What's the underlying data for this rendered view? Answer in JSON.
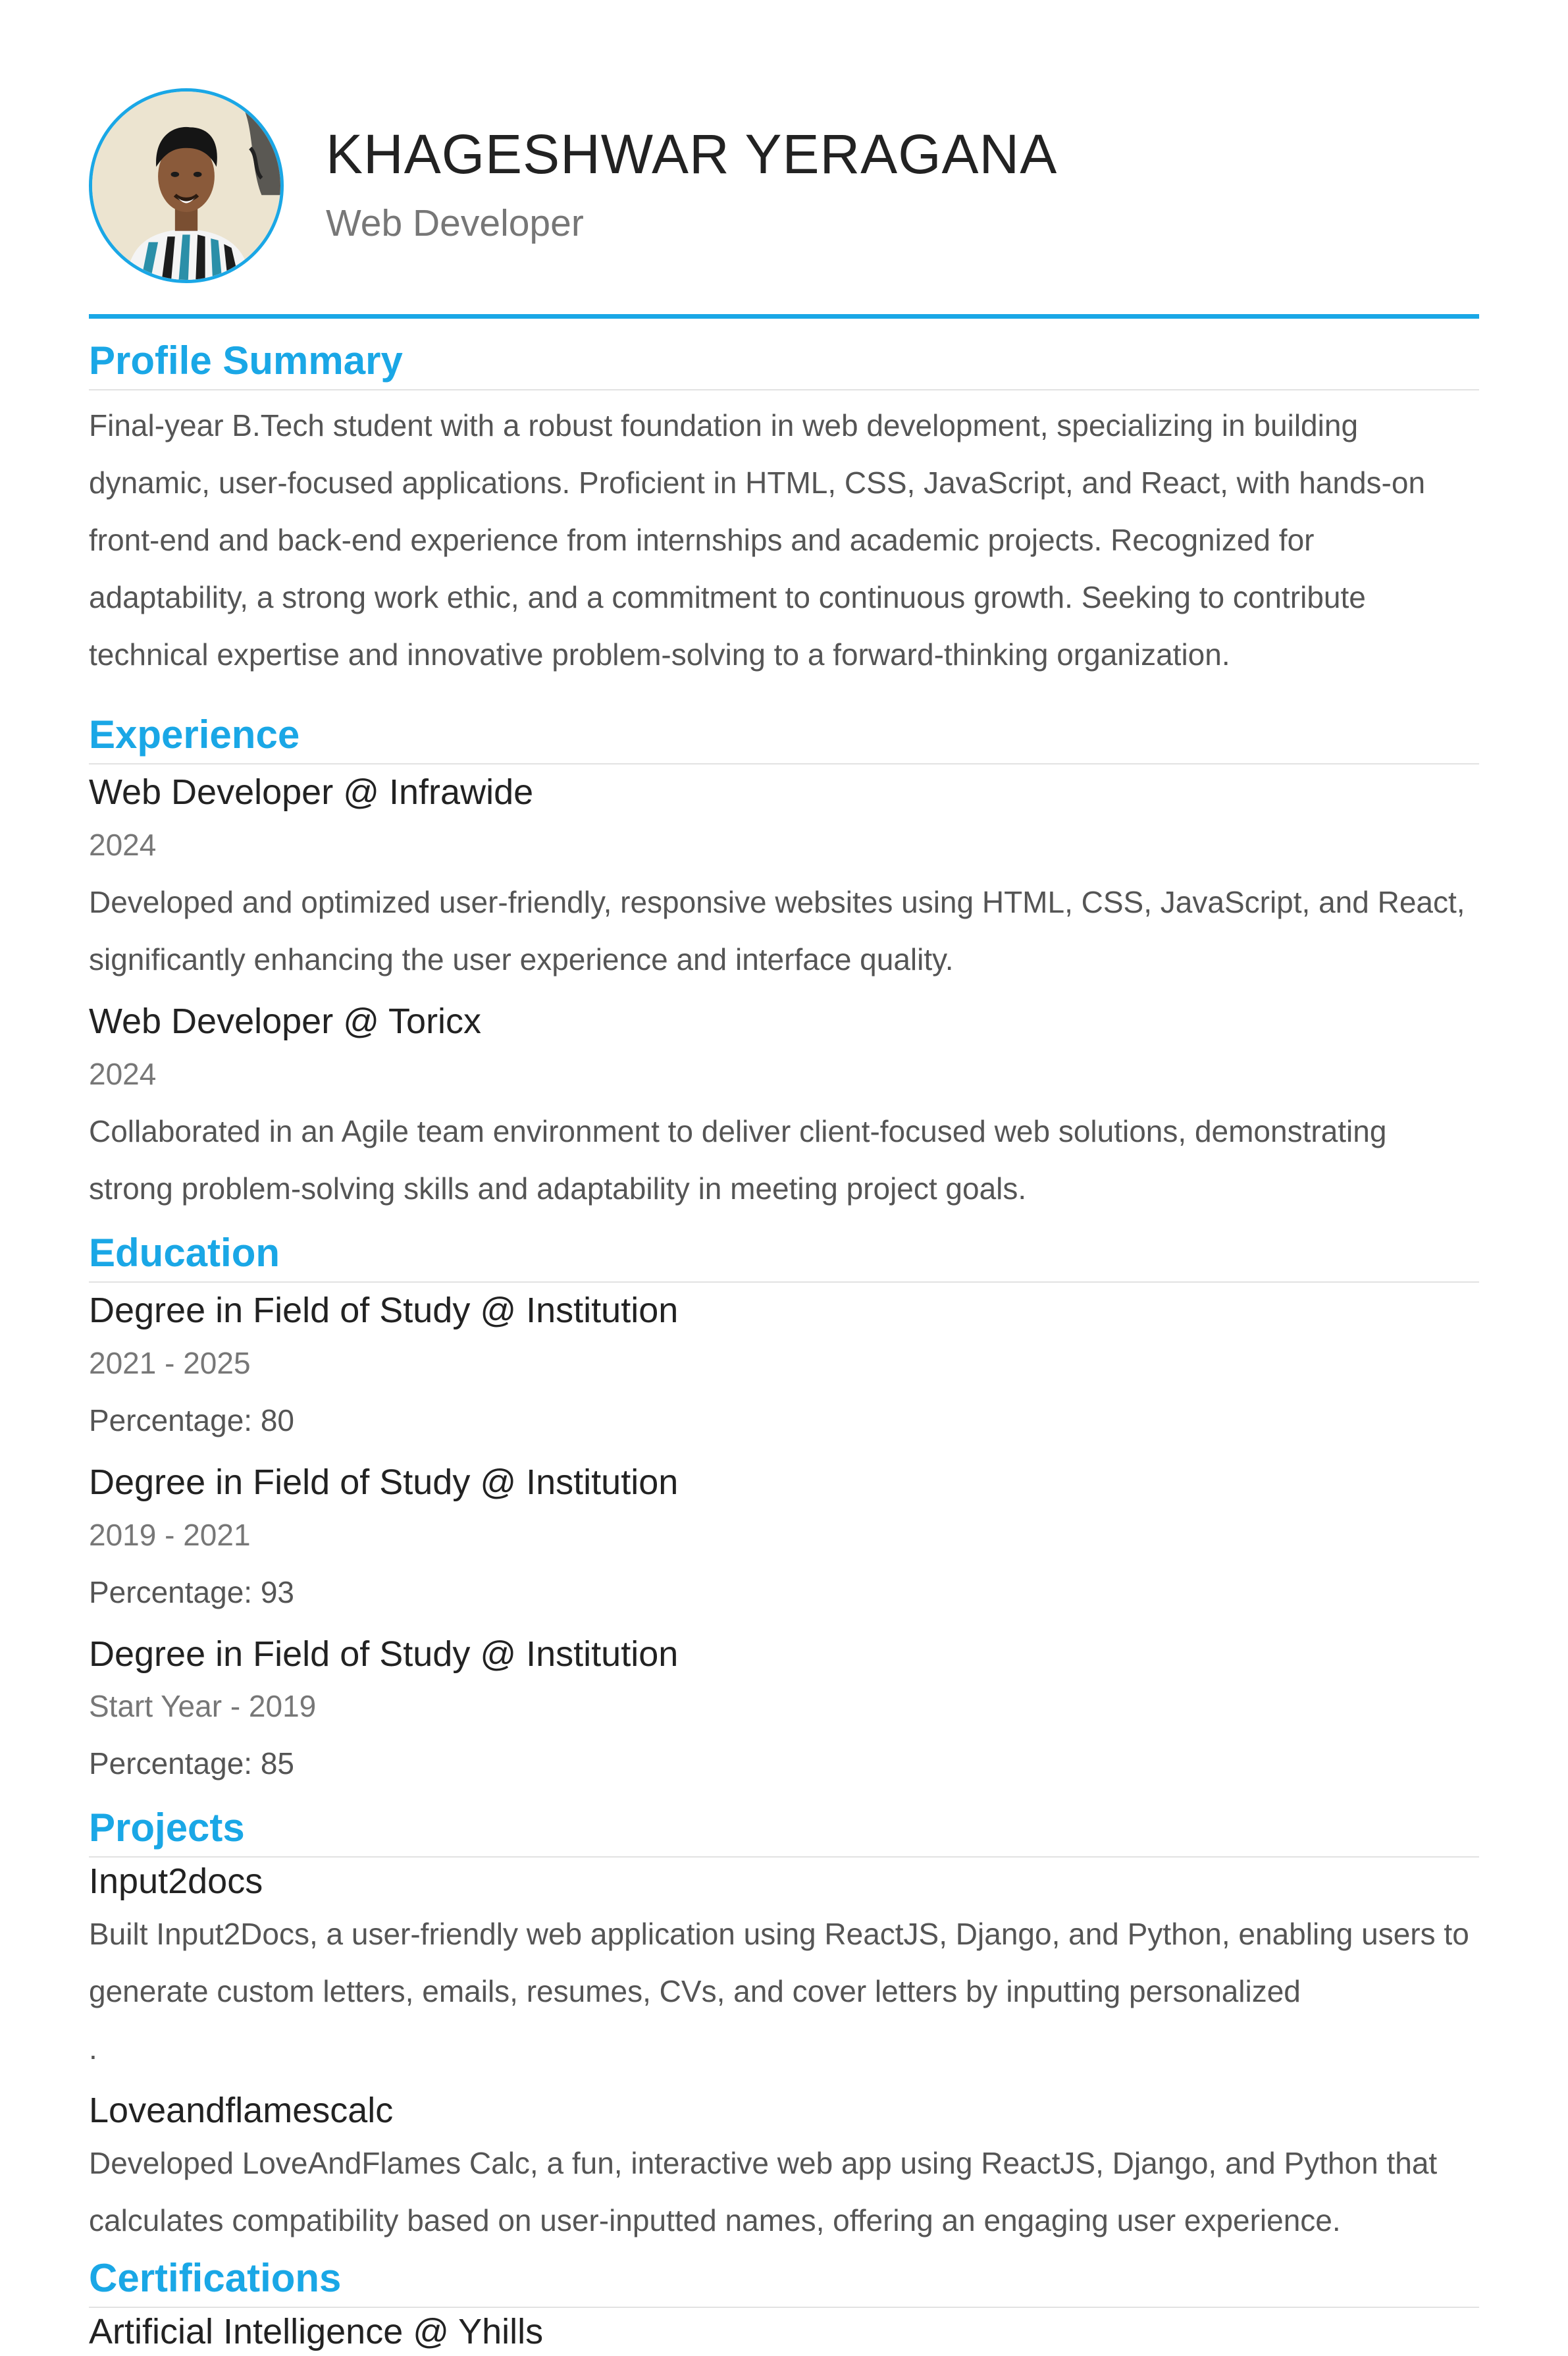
{
  "header": {
    "name": "KHAGESHWAR YERAGANA",
    "role": "Web Developer"
  },
  "summary": {
    "title": "Profile Summary",
    "text": "Final-year B.Tech student with a robust foundation in web development, specializing in building dynamic, user-focused applications. Proficient in HTML, CSS, JavaScript, and React, with hands-on front-end and back-end experience from internships and academic projects. Recognized for adaptability, a strong work ethic, and a commitment to continuous growth. Seeking to contribute technical expertise and innovative problem-solving to a forward-thinking organization."
  },
  "experience": {
    "title": "Experience",
    "items": [
      {
        "title": "Web Developer @ Infrawide",
        "date": "2024",
        "description": "Developed and optimized user-friendly, responsive websites using HTML, CSS, JavaScript, and React, significantly enhancing the user experience and interface quality."
      },
      {
        "title": "Web Developer @ Toricx",
        "date": "2024",
        "description": "Collaborated in an Agile team environment to deliver client-focused web solutions, demonstrating strong problem-solving skills and adaptability in meeting project goals."
      }
    ]
  },
  "education": {
    "title": "Education",
    "items": [
      {
        "title": "Degree in Field of Study @ Institution",
        "date": "2021 - 2025",
        "percentage": "Percentage: 80"
      },
      {
        "title": "Degree in Field of Study @ Institution",
        "date": "2019 - 2021",
        "percentage": "Percentage: 93"
      },
      {
        "title": "Degree in Field of Study @ Institution",
        "date": "Start Year - 2019",
        "percentage": "Percentage: 85"
      }
    ]
  },
  "projects": {
    "title": "Projects",
    "items": [
      {
        "title": "Input2docs",
        "description": "Built Input2Docs, a user-friendly web application using ReactJS, Django, and Python, enabling users to generate custom letters, emails, resumes, CVs, and cover letters by inputting personalized",
        "trailing": "."
      },
      {
        "title": "Loveandflamescalc",
        "description": "Developed LoveAndFlames Calc, a fun, interactive web app using ReactJS, Django, and Python that calculates compatibility based on user-inputted names, offering an engaging user experience."
      }
    ]
  },
  "certifications": {
    "title": "Certifications",
    "items": [
      {
        "title": "Artificial Intelligence @ Yhills"
      }
    ]
  },
  "colors": {
    "accent": "#1aa7e6",
    "text_dark": "#222222",
    "text_muted": "#555555",
    "text_date": "#777777"
  }
}
